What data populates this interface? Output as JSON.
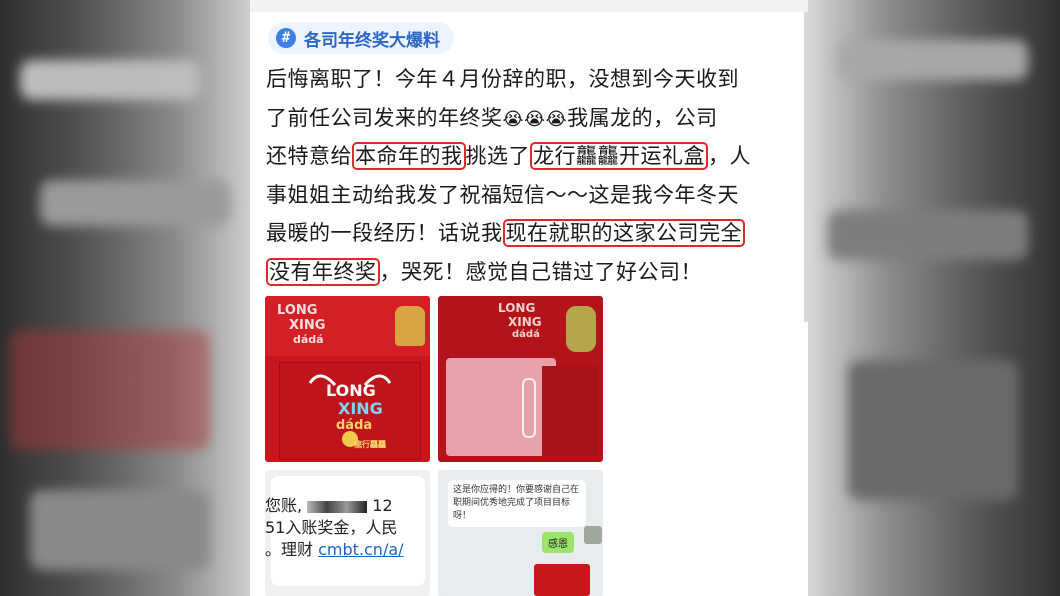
{
  "topic_tag": {
    "icon": "hashtag-icon",
    "symbol": "#",
    "label": "各司年终奖大爆料"
  },
  "post": {
    "lines": [
      [
        "后悔离职了！今年４月份辞的职，没想到今天收到"
      ],
      [
        "了前任公司发来的年终奖",
        "😭",
        "😭",
        "😭",
        "我属龙的，公司"
      ],
      [
        "还特意给",
        "本命年的我",
        "挑选了",
        "龙行龘龘开运礼盒",
        "，人"
      ],
      [
        "事姐姐主动给我发了祝福短信～～这是我今年冬天"
      ],
      [
        "最暖的一段经历！话说我",
        "现在就职的这家公司完全"
      ],
      [
        "没有年终奖",
        "，哭死！感觉自己错过了好公司！"
      ]
    ]
  },
  "photos": {
    "box_closed": {
      "brand_line1": "LONG",
      "brand_line2": "XING",
      "brand_line3": "dádá",
      "box_line1": "LONG",
      "box_line2": "XING",
      "box_line3": "dáda",
      "seal": "龍行龘龘"
    },
    "box_open": {
      "brand_line1": "LONG",
      "brand_line2": "XING",
      "brand_line3": "dádá"
    },
    "sms": {
      "line1": "您账,",
      "line1_tail": "12",
      "line2": "51入账奖金，人民",
      "line3": "。理财",
      "link": "cmbt.cn/a/"
    },
    "chat": {
      "message": "这是你应得的！你要感谢自己在职期间优秀地完成了项目目标呀！",
      "reply": "感恩"
    }
  },
  "colors": {
    "highlight_border": "#e02a2a",
    "tag_text": "#2c67c8",
    "tag_bg": "#eef4fd",
    "box_red": "#c8161d"
  }
}
